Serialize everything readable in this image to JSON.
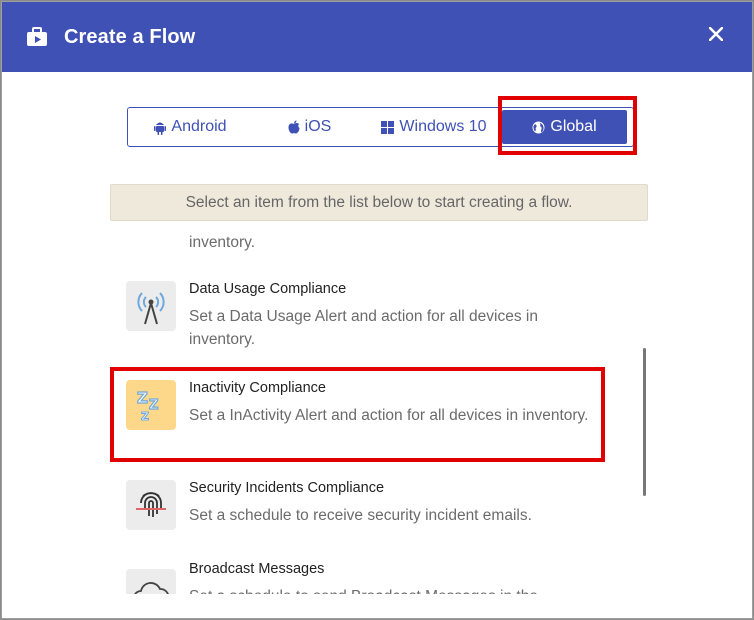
{
  "dialog": {
    "title": "Create a Flow",
    "header_color": "#3f51b5",
    "header_icon": "flow-briefcase-icon",
    "close_icon": "close-icon"
  },
  "platform_tabs": [
    {
      "label": "Android",
      "icon": "android-icon",
      "selected": false
    },
    {
      "label": "iOS",
      "icon": "apple-icon",
      "selected": false
    },
    {
      "label": "Windows 10",
      "icon": "windows-icon",
      "selected": false
    },
    {
      "label": "Global",
      "icon": "globe-icon",
      "selected": true
    }
  ],
  "notice": "Select an item from the list below to start creating a flow.",
  "list": {
    "partial_top_text": "inventory.",
    "items": [
      {
        "title": "Data Usage Compliance",
        "description": "Set a Data Usage Alert and action for all devices in inventory.",
        "icon": "antenna-signal-icon"
      },
      {
        "title": "Inactivity Compliance",
        "description": "Set a InActivity Alert and action for all devices in inventory.",
        "icon": "sleep-zzz-icon"
      },
      {
        "title": "Security Incidents Compliance",
        "description": "Set a schedule to receive security incident emails.",
        "icon": "fingerprint-icon"
      },
      {
        "title": "Broadcast Messages",
        "description": "Set a schedule to send Broadcast Messages in the",
        "icon": "cloud-icon"
      }
    ]
  },
  "highlight_color": "#e00000"
}
